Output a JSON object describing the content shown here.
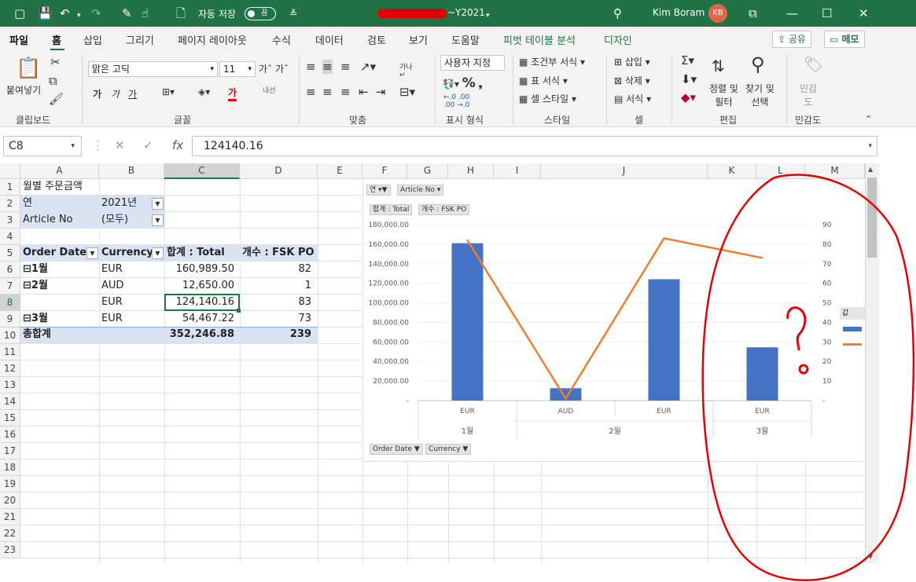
{
  "app": {
    "title_suffix": "~Y2021",
    "autosave_label": "자동 저장",
    "autosave_state": "끔",
    "user_name": "Kim Boram",
    "user_initials": "KB",
    "colors": {
      "excel_green": "#217346",
      "bar": "#4472c4",
      "line": "#ed7d31",
      "annotation": "#e40000"
    }
  },
  "tabs": [
    "파일",
    "홈",
    "삽입",
    "그리기",
    "페이지 레이아웃",
    "수식",
    "데이터",
    "검토",
    "보기",
    "도움말",
    "피벗 테이블 분석",
    "디자인"
  ],
  "share_label": "공유",
  "memo_label": "메모",
  "ribbon": {
    "paste_label": "붙여넣기",
    "font_name": "맑은 고딕",
    "font_size": "11",
    "number_format": "사용자 지정",
    "wrap_label": "내선",
    "cond_format": "조건부 서식",
    "table_format": "표 서식",
    "cell_style": "셀 스타일",
    "insert": "삽입",
    "delete": "삭제",
    "format": "서식",
    "sort_filter": "정렬 및\n필터",
    "find_select": "찾기 및\n선택",
    "sensitivity": "민감\n도",
    "groups": [
      "클립보드",
      "글꼴",
      "맞춤",
      "표시 형식",
      "스타일",
      "셀",
      "편집",
      "민감도"
    ]
  },
  "formula": {
    "namebox": "C8",
    "value": "124140.16"
  },
  "columns": [
    "A",
    "B",
    "C",
    "D",
    "E",
    "F",
    "G",
    "H",
    "I",
    "J",
    "K",
    "L",
    "M"
  ],
  "rows": [
    "1",
    "2",
    "3",
    "4",
    "5",
    "6",
    "7",
    "8",
    "9",
    "10",
    "11",
    "12",
    "13",
    "14",
    "15",
    "16",
    "17",
    "18",
    "19",
    "20",
    "21",
    "22",
    "23"
  ],
  "pivot": {
    "title": "월별 주문금액",
    "filter1_label": "연",
    "filter1_value": "2021년",
    "filter2_label": "Article No",
    "filter2_value": "(모두)",
    "headers": [
      "Order Date",
      "Currency",
      "합계 : Total",
      "개수 : FSK PO"
    ],
    "rows": [
      {
        "date": "1월",
        "currency": "EUR",
        "total": "160,989.50",
        "count": "82"
      },
      {
        "date": "2월",
        "currency": "AUD",
        "total": "12,650.00",
        "count": "1"
      },
      {
        "date": "",
        "currency": "EUR",
        "total": "124,140.16",
        "count": "83"
      },
      {
        "date": "3월",
        "currency": "EUR",
        "total": "54,467.22",
        "count": "73"
      }
    ],
    "grand_label": "총합계",
    "grand_total": "352,246.88",
    "grand_count": "239"
  },
  "chart_data": {
    "type": "bar",
    "filter_buttons": [
      "연",
      "Article No"
    ],
    "value_buttons": [
      "합계 : Total",
      "개수 : FSK PO"
    ],
    "axis_buttons": [
      "Order Date",
      "Currency"
    ],
    "categories": [
      "EUR",
      "AUD",
      "EUR",
      "EUR"
    ],
    "groups": [
      "1월",
      "2월",
      "3월"
    ],
    "series": [
      {
        "type": "bar",
        "axis": "left",
        "values": [
          160989.5,
          12650,
          124140.16,
          54467.22
        ]
      },
      {
        "type": "line",
        "axis": "right",
        "values": [
          82,
          1,
          83,
          73
        ]
      }
    ],
    "ylim": [
      0,
      180000
    ],
    "ytick_labels": [
      "-",
      "20,000.00",
      "40,000.00",
      "60,000.00",
      "80,000.00",
      "100,000.00",
      "120,000.00",
      "140,000.00",
      "160,000.00",
      "180,000.00"
    ],
    "y2lim": [
      0,
      90
    ],
    "y2tick_labels": [
      "-",
      "10",
      "20",
      "30",
      "40",
      "50",
      "60",
      "70",
      "80",
      "90"
    ],
    "legend_title": "값"
  },
  "annotation": {
    "text": "?"
  }
}
